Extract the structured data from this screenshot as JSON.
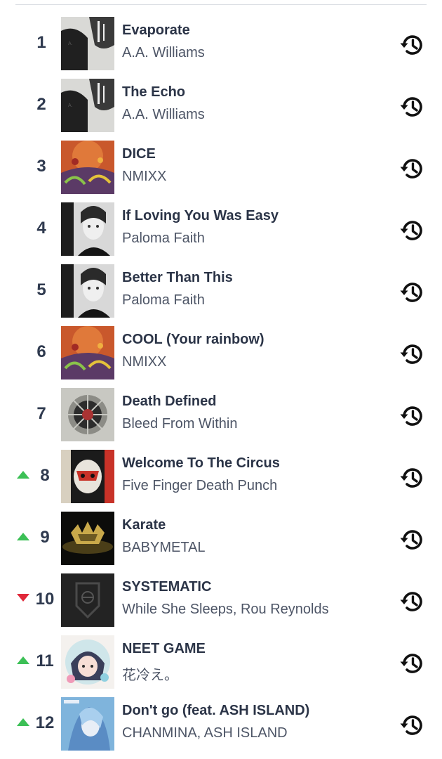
{
  "chart": {
    "tracks": [
      {
        "rank": "1",
        "title": "Evaporate",
        "artist": "A.A. Williams",
        "trend": "none",
        "art": "aa"
      },
      {
        "rank": "2",
        "title": "The Echo",
        "artist": "A.A. Williams",
        "trend": "none",
        "art": "aa"
      },
      {
        "rank": "3",
        "title": "DICE",
        "artist": "NMIXX",
        "trend": "none",
        "art": "nmixx"
      },
      {
        "rank": "4",
        "title": "If Loving You Was Easy",
        "artist": "Paloma Faith",
        "trend": "none",
        "art": "paloma"
      },
      {
        "rank": "5",
        "title": "Better Than This",
        "artist": "Paloma Faith",
        "trend": "none",
        "art": "paloma"
      },
      {
        "rank": "6",
        "title": "COOL (Your rainbow)",
        "artist": "NMIXX",
        "trend": "none",
        "art": "nmixx"
      },
      {
        "rank": "7",
        "title": "Death Defined",
        "artist": "Bleed From Within",
        "trend": "none",
        "art": "bfw"
      },
      {
        "rank": "8",
        "title": "Welcome To The Circus",
        "artist": "Five Finger Death Punch",
        "trend": "up",
        "art": "ffdp"
      },
      {
        "rank": "9",
        "title": "Karate",
        "artist": "BABYMETAL",
        "trend": "up",
        "art": "babymetal"
      },
      {
        "rank": "10",
        "title": "SYSTEMATIC",
        "artist": "While She Sleeps, Rou Reynolds",
        "trend": "down",
        "art": "wss"
      },
      {
        "rank": "11",
        "title": "NEET GAME",
        "artist": "花冷え。",
        "trend": "up",
        "art": "hanabie"
      },
      {
        "rank": "12",
        "title": "Don't go (feat. ASH ISLAND)",
        "artist": "CHANMINA, ASH ISLAND",
        "trend": "up",
        "art": "chanmina"
      }
    ],
    "history_icon": "history-icon",
    "colors": {
      "trend_up": "#3cc056",
      "trend_down": "#e0283a",
      "title": "#2b3447",
      "artist": "#4d5566"
    }
  }
}
